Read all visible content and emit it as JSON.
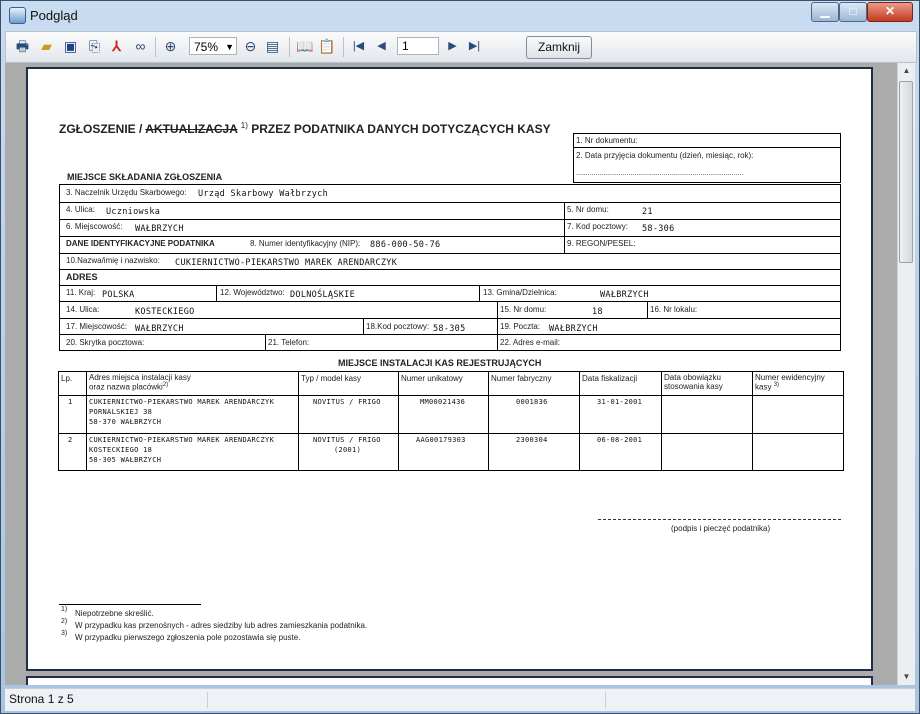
{
  "window": {
    "title": "Podgląd",
    "minimize": "▁",
    "maximize": "□",
    "close": "✕"
  },
  "toolbar": {
    "zoom_value": "75%",
    "page_value": "1",
    "close_label": "Zamknij",
    "icons": [
      "printer-icon",
      "open-folder-icon",
      "save-icon",
      "export-icon",
      "pdf-icon",
      "binoculars-icon",
      "zoom-in-icon",
      "zoom-out-icon",
      "fit-page-icon",
      "book-icon",
      "clipboard-icon",
      "first-page-icon",
      "previous-page-icon",
      "next-page-icon",
      "last-page-icon"
    ]
  },
  "form": {
    "title_part1": "ZGŁOSZENIE  /",
    "title_part2": "AKTUALIZACJA",
    "title_sup": "1)",
    "title_part3": " PRZEZ PODATNIKA DANYCH DOTYCZĄCYCH KASY",
    "doc_no_label": "1. Nr dokumentu:",
    "doc_date_label": "2. Data przyjęcia dokumentu (dzień, miesiąc, rok):",
    "doc_date_dots": "......................................................................................",
    "section_place": "MIEJSCE SKŁADANIA ZGŁOSZENIA",
    "f3_label": "3. Naczelnik Urzędu Skarbowego:",
    "f3_value": "Urząd Skarbowy Wałbrzych",
    "f4_label": "4. Ulica:",
    "f4_value": "Uczniowska",
    "f5_label": "5. Nr domu:",
    "f5_value": "21",
    "f6_label": "6. Miejscowość:",
    "f6_value": "WAŁBRZYCH",
    "f7_label": "7. Kod pocztowy:",
    "f7_value": "58-306",
    "section_id": "DANE IDENTYFIKACYJNE PODATNIKA",
    "f8_label": "8. Numer identyfikacyjny (NIP):",
    "f8_value": "886-000-50-76",
    "f9_label": "9. REGON/PESEL:",
    "f10_label": "10.Nazwa/imię i nazwisko:",
    "f10_value": "CUKIERNICTWO-PIEKARSTWO MAREK ARENDARCZYK",
    "section_address": "ADRES",
    "f11_label": "11. Kraj:",
    "f11_value": "POLSKA",
    "f12_label": "12. Województwo:",
    "f12_value": "DOLNOŚLĄSKIE",
    "f13_label": "13. Gmina/Dzielnica:",
    "f13_value": "WAŁBRZYCH",
    "f14_label": "14. Ulica:",
    "f14_value": "KOSTECKIEGO",
    "f15_label": "15. Nr domu:",
    "f15_value": "18",
    "f16_label": "16. Nr lokalu:",
    "f17_label": "17. Miejscowość:",
    "f17_value": "WAŁBRZYCH",
    "f18_label": "18.Kod pocztowy:",
    "f18_value": "58-305",
    "f19_label": "19. Poczta:",
    "f19_value": "WAŁBRZYCH",
    "f20_label": "20. Skrytka pocztowa:",
    "f21_label": "21. Telefon:",
    "f22_label": "22. Adres e-mail:",
    "section_install": "MIEJSCE INSTALACJI KAS REJESTRUJĄCYCH",
    "table_headers": {
      "lp": "Lp.",
      "addr1": "Adres miejsca instalacji kasy",
      "addr2": "oraz nazwa placówki",
      "addr_sup": "2)",
      "type": "Typ / model kasy",
      "unique": "Numer unikatowy",
      "factory": "Numer fabryczny",
      "fiscal": "Data fiskalizacji",
      "mandatory1": "Data obowiązku",
      "mandatory2": "stosowania kasy",
      "reg1": "Numer ewidencyjny",
      "reg2": "kasy",
      "reg_sup": "3)"
    },
    "rows": [
      {
        "lp": "1",
        "addr1": "CUKIERNICTWO-PIEKARSTWO MAREK ARENDARCZYK",
        "addr2": "PORNALSKIEJ 38",
        "addr3": "58-370 WAŁBRZYCH",
        "type1": "NOVITUS / FRIGO",
        "type2": "",
        "unique": "MM00021436",
        "factory": "0001836",
        "fiscal": "31-01-2001"
      },
      {
        "lp": "2",
        "addr1": "CUKIERNICTWO-PIEKARSTWO MAREK ARENDARCZYK",
        "addr2": "KOSTECKIEGO 18",
        "addr3": "58-305 WAŁBRZYCH",
        "type1": "NOVITUS / FRIGO",
        "type2": "(2001)",
        "unique": "AAG00179303",
        "factory": "2300304",
        "fiscal": "06-08-2001"
      }
    ],
    "signature_label": "(podpis i pieczęć podatnika)",
    "footnotes": [
      {
        "n": "1)",
        "text": "Niepotrzebne skreślić."
      },
      {
        "n": "2)",
        "text": "W przypadku kas przenośnych - adres siedziby lub adres zamieszkania podatnika."
      },
      {
        "n": "3)",
        "text": "W przypadku pierwszego zgłoszenia pole pozostawia się puste."
      }
    ]
  },
  "status": {
    "page_info": "Strona 1 z 5"
  }
}
